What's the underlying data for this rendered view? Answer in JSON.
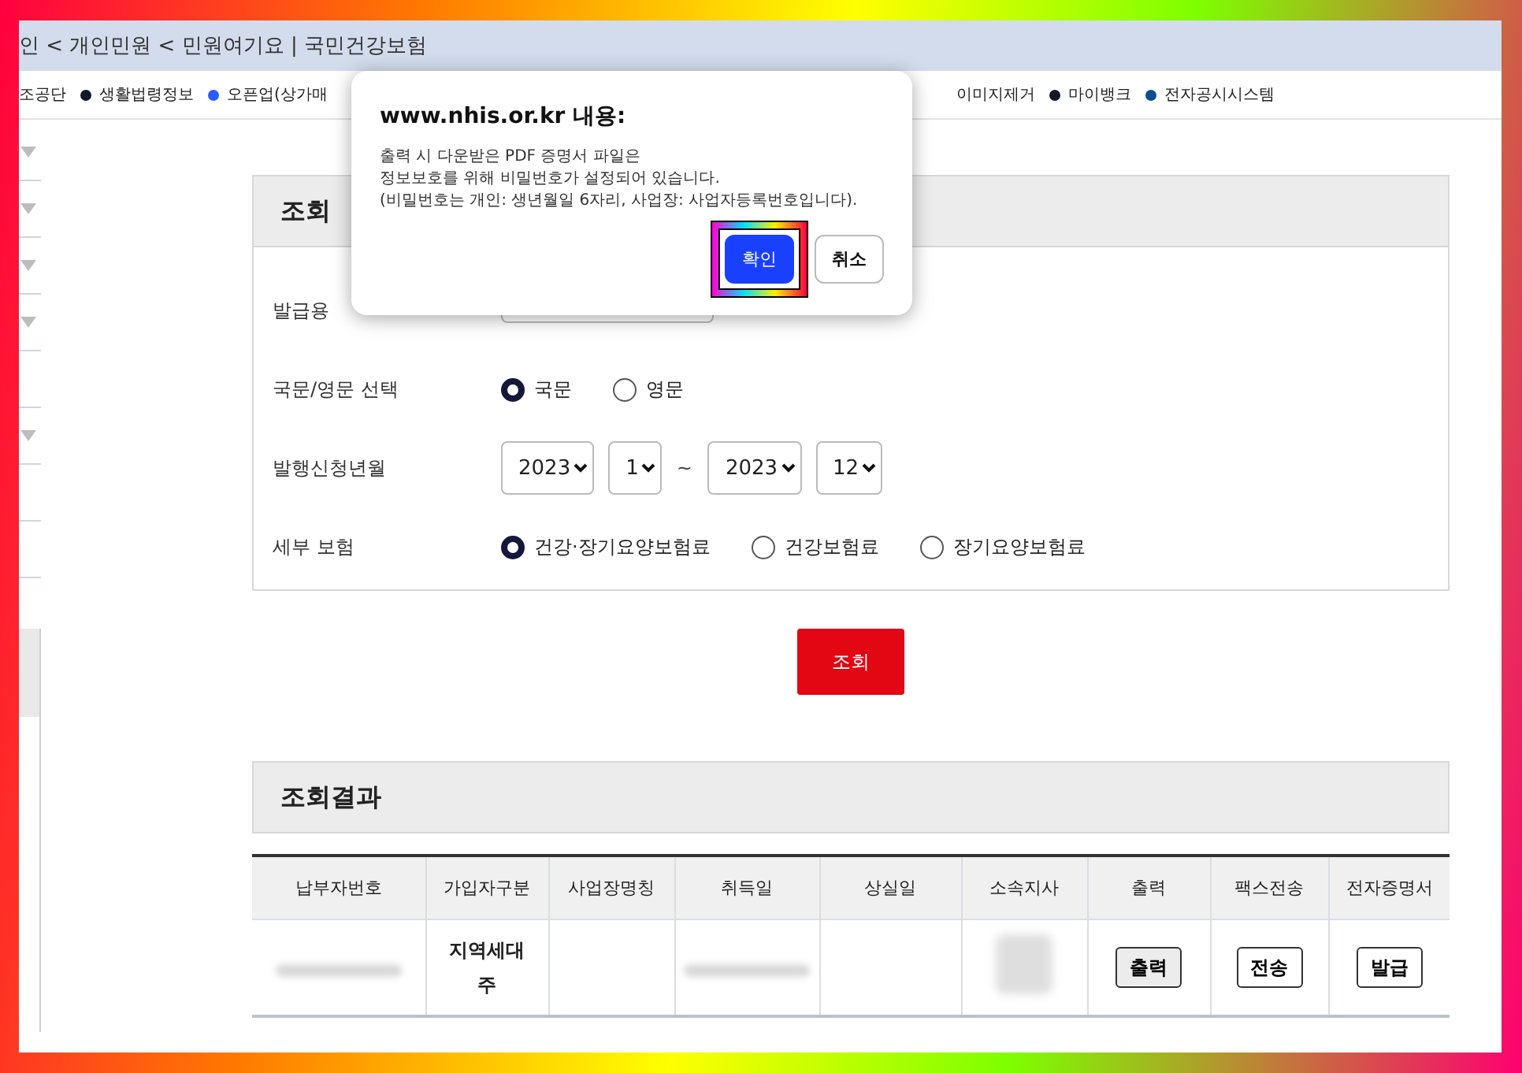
{
  "breadcrumb": "인 < 개인민원 < 민원여기요 | 국민건강보험",
  "top_links_left": [
    {
      "label": "조공단"
    },
    {
      "label": "생활법령정보",
      "color": "#111827"
    },
    {
      "label": "오픈업(상가매",
      "color": "#2a5cff"
    }
  ],
  "top_links_right": [
    {
      "label": "이미지제거"
    },
    {
      "label": "마이뱅크",
      "color": "#111827"
    },
    {
      "label": "전자공시시스템",
      "color": "#0b4f8f"
    }
  ],
  "sidebar": {
    "items": [
      {
        "kind": "dropdown"
      },
      {
        "kind": "dropdown"
      },
      {
        "kind": "dropdown"
      },
      {
        "kind": "dropdown"
      },
      {
        "kind": "plain"
      },
      {
        "kind": "dropdown"
      },
      {
        "kind": "plain"
      },
      {
        "kind": "plain"
      }
    ]
  },
  "search": {
    "title": "조회",
    "rows": [
      {
        "label": "발급용",
        "kind": "select-partial"
      },
      {
        "label": "국문/영문 선택",
        "kind": "radio",
        "options": [
          {
            "label": "국문",
            "selected": true
          },
          {
            "label": "영문",
            "selected": false
          }
        ]
      },
      {
        "label": "발행신청년월",
        "kind": "period",
        "selects": [
          "2023",
          "1",
          "2023",
          "12"
        ],
        "separator": "~"
      },
      {
        "label": "세부 보험",
        "kind": "radio",
        "options": [
          {
            "label": "건강·장기요양보험료",
            "selected": true
          },
          {
            "label": "건강보험료",
            "selected": false
          },
          {
            "label": "장기요양보험료",
            "selected": false
          }
        ]
      }
    ],
    "button": "조회"
  },
  "results": {
    "title": "조회결과",
    "columns": [
      "납부자번호",
      "가입자구분",
      "사업장명칭",
      "취득일",
      "상실일",
      "소속지사",
      "출력",
      "팩스전송",
      "전자증명서"
    ],
    "rows": [
      {
        "cells": [
          {
            "kind": "blurred"
          },
          {
            "kind": "text",
            "text": "지역세대주"
          },
          {
            "kind": "empty"
          },
          {
            "kind": "blurred"
          },
          {
            "kind": "empty"
          },
          {
            "kind": "blurred2"
          },
          {
            "kind": "button",
            "text": "출력",
            "pressed": true
          },
          {
            "kind": "button",
            "text": "전송",
            "pressed": false
          },
          {
            "kind": "button",
            "text": "발급",
            "pressed": false
          }
        ]
      }
    ]
  },
  "dialog": {
    "title": "www.nhis.or.kr 내용:",
    "message": [
      "출력 시 다운받은 PDF 증명서 파일은",
      "정보보호를 위해 비밀번호가 설정되어 있습니다.",
      "(비밀번호는 개인: 생년월일 6자리, 사업장: 사업자등록번호입니다)."
    ],
    "buttons": [
      {
        "label": "확인",
        "kind": "primary",
        "highlighted": true
      },
      {
        "label": "취소",
        "kind": "secondary",
        "highlighted": false
      }
    ]
  }
}
